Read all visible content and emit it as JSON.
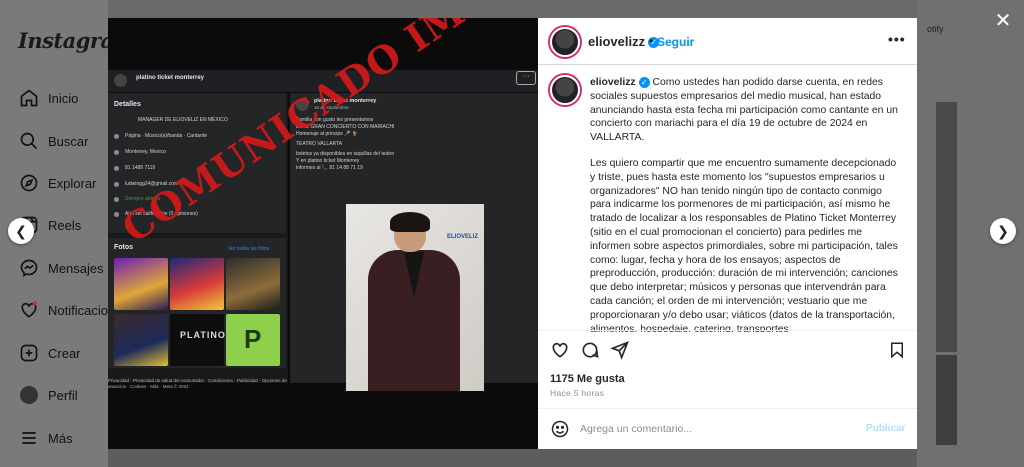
{
  "sidebar": {
    "logo": "Instagram",
    "items": [
      {
        "label": "Inicio",
        "icon": "home-icon"
      },
      {
        "label": "Buscar",
        "icon": "search-icon"
      },
      {
        "label": "Explorar",
        "icon": "compass-icon"
      },
      {
        "label": "Reels",
        "icon": "reels-icon"
      },
      {
        "label": "Mensajes",
        "icon": "messenger-icon"
      },
      {
        "label": "Notificacio",
        "icon": "heart-icon"
      },
      {
        "label": "Crear",
        "icon": "plus-icon"
      },
      {
        "label": "Perfil",
        "icon": "avatar-icon"
      },
      {
        "label": "Más",
        "icon": "menu-icon"
      }
    ]
  },
  "background": {
    "top_right_text": "otify"
  },
  "media": {
    "page_name": "platino ticket monterrey",
    "details_title": "Detalles",
    "details_subtitle": "MANAGER DE ELIOVELIZ EN MÉXICO",
    "details_rows": [
      "Página · Músico(a)/banda · Cantante",
      "Monterrey, Mexico",
      "81 1488 7119",
      "ludwingg24@gmail.com",
      "Siempre abierto",
      "Aún sin calificación (0 opiniones)"
    ],
    "photos_title": "Fotos",
    "photos_link": "Ver todas las fotos",
    "post_author": "platino ticket monterrey",
    "post_date": "16 de septiembre · ",
    "post_lines": [
      "Familia con gusto les presentamos",
      "ESTE GRAN CONCIERTO CON MARIACHI",
      " Homenaje al principe 🎤 🐓",
      "",
      "TEATRO VALLARTA",
      "",
      "boletos ya disponibles en taquillas del teatro",
      " Y en platino ticket Monterrey",
      "informes al 📞 81 14 88 71 19"
    ],
    "footer": "Privacidad · Privacidad de salud del consumidor · Condiciones · Publicidad · Opciones de anuncios · Cookies · Más · Meta © 2024",
    "stamp_text": "COMUNICADO IMPORTANTE"
  },
  "post": {
    "username": "eliovelizz",
    "follow_label": "Seguir",
    "caption_p1": "Como ustedes han podido darse cuenta, en redes sociales supuestos empresarios del medio musical, han estado anunciando hasta esta fecha mi participación como cantante en un concierto con mariachi para el día 19 de octubre de 2024 en VALLARTA.",
    "caption_p2": "Les quiero compartir que me encuentro sumamente decepcionado y triste, pues hasta este momento los \"supuestos empresarios u organizadores\" NO han tenido ningún tipo de contacto conmigo para indicarme los pormenores de mi participación, así mismo he tratado de localizar a los responsables de Platino Ticket Monterrey (sitio en el cual promocionan el concierto) para pedirles me informen sobre aspectos primordiales, sobre mi participación, tales como: lugar, fecha y hora de los ensayos; aspectos de preproducción, producción: duración de mi intervención; canciones que debo interpretar; músicos y personas que intervendrán para cada canción; el orden de mi intervención; vestuario que me proporcionaran y/o debo usar; viáticos (datos de la transportación, alimentos, hospedaje, catering, transportes",
    "likes": "1175 Me gusta",
    "time": "Hace 5 horas",
    "comment_placeholder": "Agrega un comentario...",
    "publish_label": "Publicar"
  },
  "colors": {
    "accent": "#0095f6",
    "stamp": "#d21a1a"
  }
}
